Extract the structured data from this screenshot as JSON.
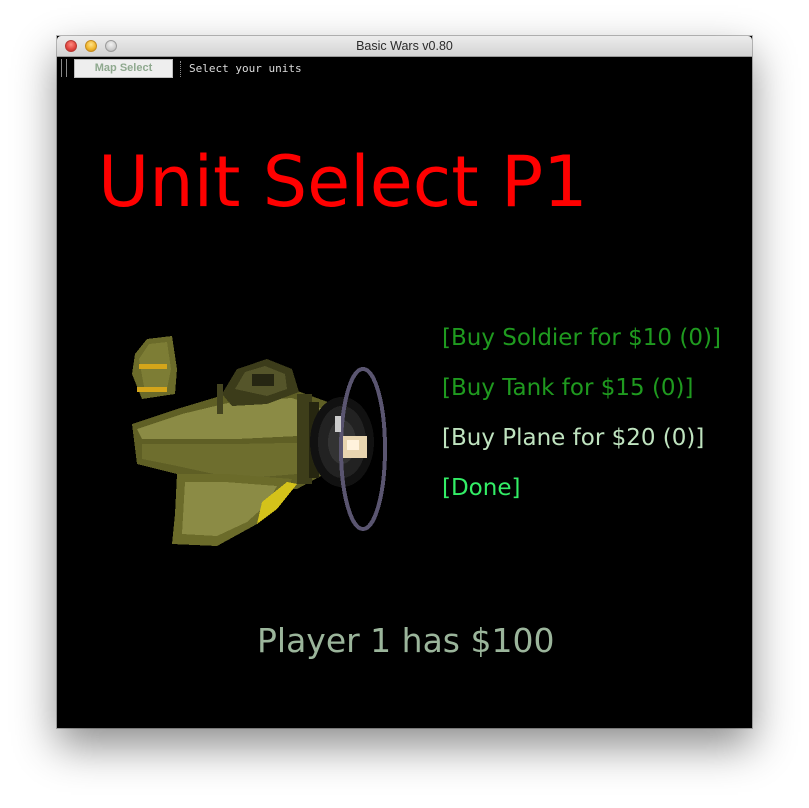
{
  "window": {
    "title": "Basic Wars v0.80"
  },
  "toolbar": {
    "map_select_label": "Map Select",
    "status_text": "Select your units"
  },
  "screen": {
    "heading": "Unit Select P1",
    "menu": [
      {
        "label": "[Buy Soldier for $10 (0)]",
        "color": "#1f9a1f"
      },
      {
        "label": "[Buy Tank for $15 (0)]",
        "color": "#1f9a1f"
      },
      {
        "label": "[Buy Plane for $20 (0)]",
        "color": "#bfe3bf"
      },
      {
        "label": "[Done]",
        "color": "#33ee66"
      }
    ],
    "player_money": "Player 1 has $100",
    "unit_preview_icon": "biplane-sprite-icon"
  },
  "colors": {
    "heading": "#ff0000",
    "money": "#9bb59b",
    "background": "#000000"
  }
}
